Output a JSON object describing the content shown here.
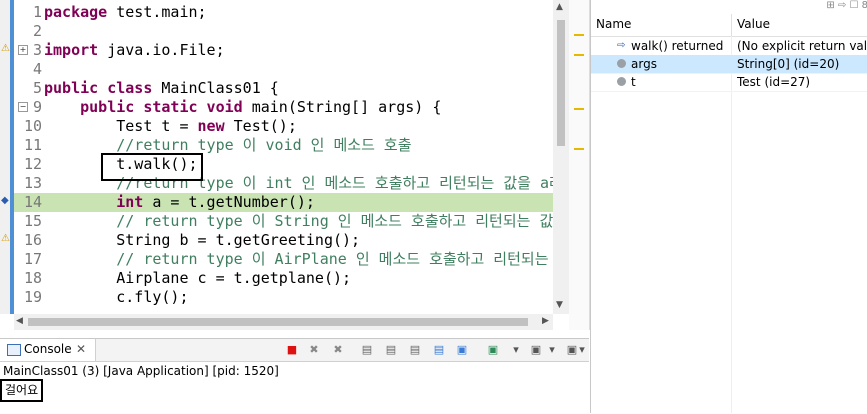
{
  "editor": {
    "lines": [
      {
        "num": "1",
        "parts": [
          [
            "kw",
            "package"
          ],
          [
            "t",
            " test.main;"
          ]
        ]
      },
      {
        "num": "2",
        "parts": []
      },
      {
        "num": "3",
        "parts": [
          [
            "kw",
            "import"
          ],
          [
            "t",
            " java.io.File;"
          ]
        ]
      },
      {
        "num": "4",
        "parts": []
      },
      {
        "num": "5",
        "parts": [
          [
            "kw",
            "public class"
          ],
          [
            "t",
            " MainClass01 {"
          ]
        ]
      },
      {
        "num": "9",
        "parts": [
          [
            "t",
            "    "
          ],
          [
            "kw",
            "public static void"
          ],
          [
            "t",
            " main(String[] args) {"
          ]
        ]
      },
      {
        "num": "10",
        "parts": [
          [
            "t",
            "        Test t = "
          ],
          [
            "kw",
            "new"
          ],
          [
            "t",
            " Test();"
          ]
        ]
      },
      {
        "num": "11",
        "parts": [
          [
            "cm",
            "        //return type 이 void 인 메소드 호출"
          ]
        ]
      },
      {
        "num": "12",
        "parts": [
          [
            "t",
            "        t.walk();"
          ]
        ]
      },
      {
        "num": "13",
        "parts": [
          [
            "cm",
            "        //return type 이 int 인 메소드 호출하고 리턴되는 값을 a라는"
          ]
        ]
      },
      {
        "num": "14",
        "parts": [
          [
            "t",
            "        "
          ],
          [
            "kw",
            "int"
          ],
          [
            "t",
            " a = t.getNumber();"
          ]
        ]
      },
      {
        "num": "15",
        "parts": [
          [
            "cm",
            "        // return type 이 String 인 메소드 호출하고 리턴되는 값을 b"
          ]
        ]
      },
      {
        "num": "16",
        "parts": [
          [
            "t",
            "        String b = t.getGreeting();"
          ]
        ]
      },
      {
        "num": "17",
        "parts": [
          [
            "cm",
            "        // return type 이 AirPlane 인 메소드 호출하고 리턴되는 값을"
          ]
        ]
      },
      {
        "num": "18",
        "parts": [
          [
            "t",
            "        Airplane c = t.getplane();"
          ]
        ]
      },
      {
        "num": "19",
        "parts": [
          [
            "t",
            "        c.fly();"
          ]
        ]
      }
    ],
    "current_line": "14"
  },
  "icons": {
    "fold_expand": "+",
    "fold_collapse": "−",
    "scroll_up": "▲",
    "scroll_down": "▼",
    "scroll_left": "◀",
    "scroll_right": "▶",
    "breakpoint": "◆",
    "close": "✕",
    "return": "⇨",
    "toolbar": [
      "■",
      "✖",
      "✖",
      "▤",
      "▤",
      "▤",
      "▤",
      "▣",
      "▣",
      "▾",
      "▣",
      "▾",
      "▣",
      "▾"
    ]
  },
  "variables": {
    "headers": {
      "name": "Name",
      "value": "Value"
    },
    "rows": [
      {
        "name": "walk() returned",
        "value": "(No explicit return valu...",
        "selected": false,
        "icon": "return"
      },
      {
        "name": "args",
        "value": "String[0]  (id=20)",
        "selected": true,
        "icon": "local"
      },
      {
        "name": "t",
        "value": "Test  (id=27)",
        "selected": false,
        "icon": "local"
      }
    ],
    "toolbar_hint": "⊞ ⇨ ☐ 8"
  },
  "console": {
    "tab_label": "Console",
    "description": "MainClass01 (3) [Java Application]  [pid: 1520]",
    "output": "걸어요"
  },
  "colors": {
    "keyword": "#7f0055",
    "comment": "#3f7f5f",
    "exec_line": "#c9e3b3",
    "selection": "#cce8ff"
  }
}
